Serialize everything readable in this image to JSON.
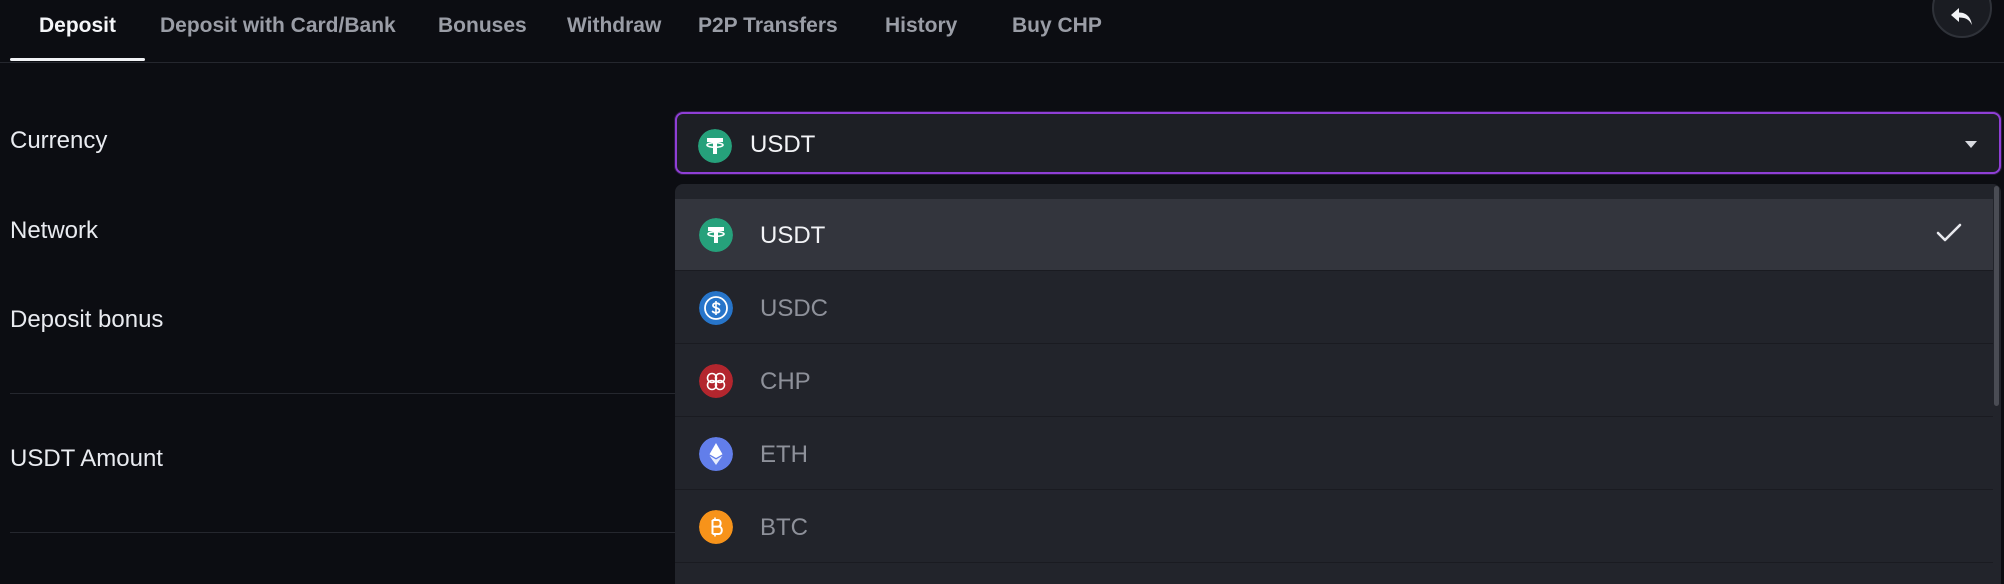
{
  "tabs": [
    {
      "label": "Deposit",
      "active": true
    },
    {
      "label": "Deposit with Card/Bank",
      "active": false
    },
    {
      "label": "Bonuses",
      "active": false
    },
    {
      "label": "Withdraw",
      "active": false
    },
    {
      "label": "P2P Transfers",
      "active": false
    },
    {
      "label": "History",
      "active": false
    },
    {
      "label": "Buy CHP",
      "active": false
    }
  ],
  "back_button": {
    "icon": "undo-arrow-icon"
  },
  "form": {
    "currency_label": "Currency",
    "network_label": "Network",
    "deposit_bonus_label": "Deposit bonus",
    "amount_label": "USDT Amount"
  },
  "currency_select": {
    "value": "USDT",
    "icon": "tether-icon"
  },
  "dropdown": {
    "options": [
      {
        "label": "USDT",
        "icon": "tether-icon",
        "color": "#26a17b",
        "selected": true
      },
      {
        "label": "USDC",
        "icon": "usd-coin-icon",
        "color": "#2775ca",
        "selected": false
      },
      {
        "label": "CHP",
        "icon": "chp-coin-icon",
        "color": "#b3262e",
        "selected": false
      },
      {
        "label": "ETH",
        "icon": "ethereum-icon",
        "color": "#627eea",
        "selected": false
      },
      {
        "label": "BTC",
        "icon": "bitcoin-icon",
        "color": "#f7931a",
        "selected": false
      }
    ]
  },
  "colors": {
    "accent": "#8f3fd6",
    "background": "#0c0d12",
    "surface": "#22242b"
  }
}
